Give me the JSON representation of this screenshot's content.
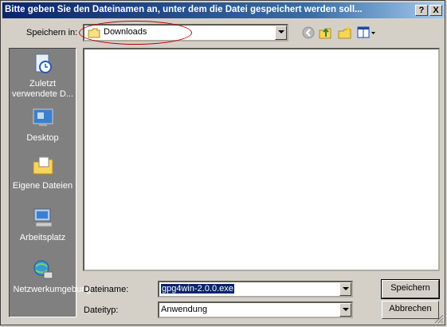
{
  "window": {
    "title": "Bitte geben Sie den Dateinamen an, unter dem die Datei gespeichert werden soll...",
    "help_button": "?",
    "close_button": "X"
  },
  "save_in": {
    "label": "Speichern in:",
    "value": "Downloads",
    "icon": "folder-icon"
  },
  "toolbar": {
    "icons": [
      "back-icon",
      "up-folder-icon",
      "new-folder-icon",
      "view-menu-icon"
    ]
  },
  "places": [
    {
      "label": "Zuletzt verwendete D...",
      "icon": "recent-documents-icon"
    },
    {
      "label": "Desktop",
      "icon": "desktop-icon"
    },
    {
      "label": "Eigene Dateien",
      "icon": "my-documents-icon"
    },
    {
      "label": "Arbeitsplatz",
      "icon": "my-computer-icon"
    },
    {
      "label": "Netzwerkumgebung",
      "icon": "network-icon"
    }
  ],
  "filename": {
    "label": "Dateiname:",
    "value": "gpg4win-2.0.0.exe"
  },
  "filetype": {
    "label": "Dateityp:",
    "value": "Anwendung"
  },
  "buttons": {
    "save": "Speichern",
    "cancel": "Abbrechen"
  },
  "colors": {
    "title_bar": "#0a246a",
    "dialog_bg": "#d4d0c8",
    "annotation": "#c00000"
  }
}
